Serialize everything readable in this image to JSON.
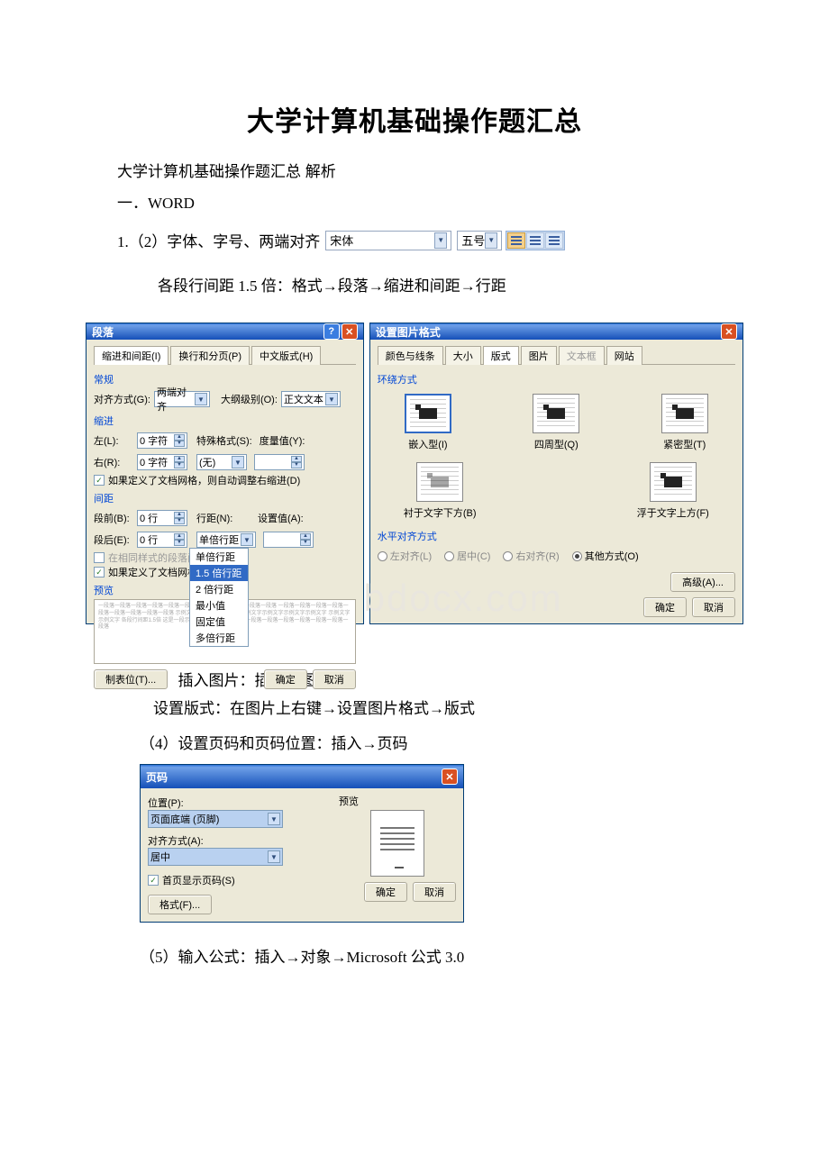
{
  "title": "大学计算机基础操作题汇总",
  "subtitle": "大学计算机基础操作题汇总 解析",
  "section1": "一．WORD",
  "item1": "1.（2）字体、字号、两端对齐",
  "font_name": "宋体",
  "font_size": "五号",
  "item1b": "各段行间距 1.5 倍：格式→段落→缩进和间距→行距",
  "dlg_para": {
    "title": "段落",
    "tabs": [
      "缩进和间距(I)",
      "换行和分页(P)",
      "中文版式(H)"
    ],
    "group_general": "常规",
    "align_label": "对齐方式(G):",
    "align_value": "两端对齐",
    "outline_label": "大纲级别(O):",
    "outline_value": "正文文本",
    "group_indent": "缩进",
    "left_label": "左(L):",
    "left_value": "0 字符",
    "right_label": "右(R):",
    "right_value": "0 字符",
    "special_label": "特殊格式(S):",
    "special_value": "(无)",
    "by_label": "度量值(Y):",
    "chk_grid": "如果定义了文档网格，则自动调整右缩进(D)",
    "group_spacing": "间距",
    "before_label": "段前(B):",
    "before_value": "0 行",
    "after_label": "段后(E):",
    "after_value": "0 行",
    "linespace_label": "行距(N):",
    "linespace_value": "单倍行距",
    "setval_label": "设置值(A):",
    "chk_nospace": "在相同样式的段落间不添加空格",
    "chk_grid2": "如果定义了文档网格，则对齐",
    "dd_items": [
      "单倍行距",
      "1.5 倍行距",
      "2 倍行距",
      "最小值",
      "固定值",
      "多倍行距"
    ],
    "group_preview": "预览",
    "preview": "一段落一段落一段落一段落一段落一段落一段落一段落一段落一段落一段落\n一段落一段落一段落一段落一段落一段落一段落一段落一段落\n示例文字示例文字示例文字示例文字示例文字示例文字示例文字\n示例文字示例文字\n各段行间距1.5倍 这是一段示例\n一段落一段落一段落一段落一段落一段落一段落一段落一段落一段落",
    "tabstops_btn": "制表位(T)...",
    "ok": "确定",
    "cancel": "取消"
  },
  "dlg_pic": {
    "title": "设置图片格式",
    "tabs": [
      "颜色与线条",
      "大小",
      "版式",
      "图片",
      "文本框",
      "网站"
    ],
    "wrap_label": "环绕方式",
    "wrap_items": [
      "嵌入型(I)",
      "四周型(Q)",
      "紧密型(T)",
      "衬于文字下方(B)",
      "浮于文字上方(F)"
    ],
    "halign_label": "水平对齐方式",
    "h_items": [
      "左对齐(L)",
      "居中(C)",
      "右对齐(R)",
      "其他方式(O)"
    ],
    "advanced": "高级(A)...",
    "ok": "确定",
    "cancel": "取消"
  },
  "item3": "（3）插入图片：插入→图片",
  "item3b": "设置版式：在图片上右键→设置图片格式→版式",
  "item4": "（4）设置页码和页码位置：插入→页码",
  "dlg_page": {
    "title": "页码",
    "pos_label": "位置(P):",
    "pos_value": "页面底端 (页脚)",
    "align_label": "对齐方式(A):",
    "align_value": "居中",
    "chk_first": "首页显示页码(S)",
    "preview_label": "预览",
    "format_btn": "格式(F)...",
    "ok": "确定",
    "cancel": "取消"
  },
  "item5": "（5）输入公式：插入→对象→Microsoft 公式 3.0",
  "watermark": "www.bdocx.com"
}
